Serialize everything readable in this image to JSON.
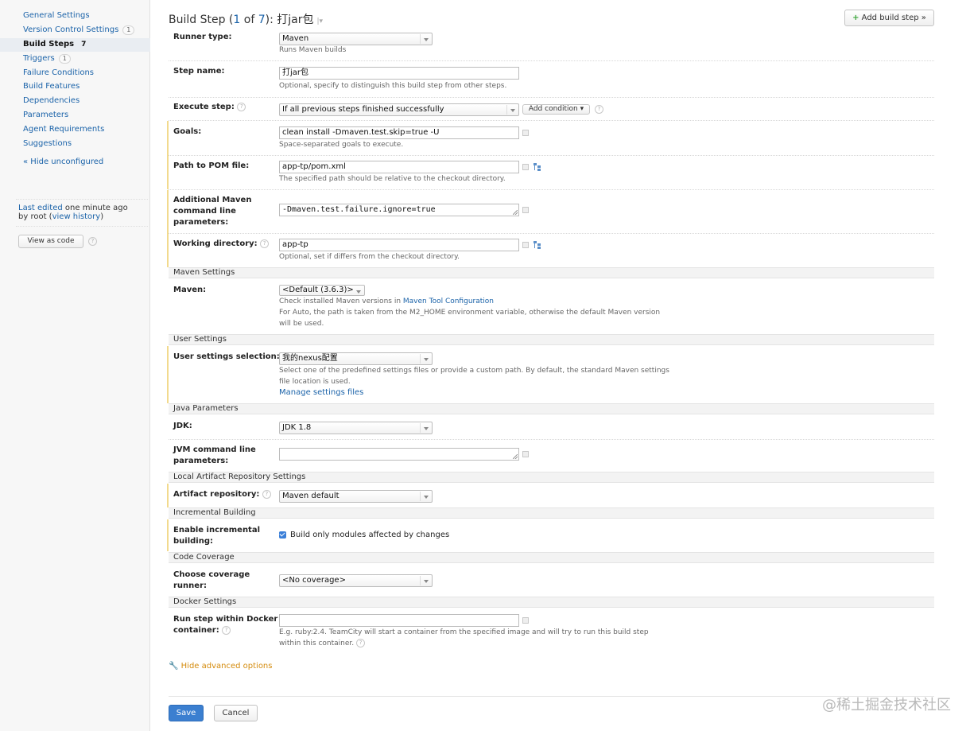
{
  "sidebar": {
    "items": [
      {
        "label": "General Settings",
        "count": ""
      },
      {
        "label": "Version Control Settings",
        "count": "1"
      },
      {
        "label": "Build Steps",
        "count": "7"
      },
      {
        "label": "Triggers",
        "count": "1"
      },
      {
        "label": "Failure Conditions",
        "count": ""
      },
      {
        "label": "Build Features",
        "count": ""
      },
      {
        "label": "Dependencies",
        "count": ""
      },
      {
        "label": "Parameters",
        "count": ""
      },
      {
        "label": "Agent Requirements",
        "count": ""
      },
      {
        "label": "Suggestions",
        "count": ""
      }
    ],
    "hide_unconfigured": "« Hide unconfigured",
    "last_edited_link": "Last edited",
    "last_edited_time": "one minute ago",
    "by_user": "by root",
    "view_history": "view history",
    "view_as_code": "View as code"
  },
  "header": {
    "title_prefix": "Build Step (",
    "step_index": "1",
    "of": " of ",
    "step_total": "7",
    "title_suffix": "): 打jar包",
    "add_build_step": "Add build step »",
    "add_icon": "+"
  },
  "form": {
    "runner_type": {
      "label": "Runner type:",
      "value": "Maven",
      "note": "Runs Maven builds"
    },
    "step_name": {
      "label": "Step name:",
      "value": "打jar包",
      "note": "Optional, specify to distinguish this build step from other steps."
    },
    "execute_step": {
      "label": "Execute step:",
      "value": "If all previous steps finished successfully",
      "add_condition": "Add condition"
    },
    "goals": {
      "label": "Goals:",
      "value": "clean install -Dmaven.test.skip=true -U",
      "note": "Space-separated goals to execute."
    },
    "pom_path": {
      "label": "Path to POM file:",
      "value": "app-tp/pom.xml",
      "note": "The specified path should be relative to the checkout directory."
    },
    "additional_params": {
      "label_1": "Additional Maven",
      "label_2": "command line",
      "label_3": "parameters:",
      "value": "-Dmaven.test.failure.ignore=true"
    },
    "working_dir": {
      "label": "Working directory:",
      "value": "app-tp",
      "note": "Optional, set if differs from the checkout directory."
    },
    "maven_settings": {
      "section": "Maven Settings",
      "label": "Maven:",
      "value": "<Default (3.6.3)>",
      "note_1_prefix": "Check installed Maven versions in ",
      "note_1_link": "Maven Tool Configuration",
      "note_2": "For Auto, the path is taken from the M2_HOME environment variable, otherwise the default Maven version",
      "note_3": "will be used."
    },
    "user_settings": {
      "section": "User Settings",
      "label": "User settings selection:",
      "value": "我的nexus配置",
      "note_1": "Select one of the predefined settings files or provide a custom path. By default, the standard Maven settings",
      "note_2": "file location is used.",
      "manage_link": "Manage settings files"
    },
    "java": {
      "section": "Java Parameters",
      "jdk_label": "JDK:",
      "jdk_value": "JDK 1.8",
      "jvm_label_1": "JVM command line",
      "jvm_label_2": "parameters:",
      "jvm_value": ""
    },
    "local_repo": {
      "section": "Local Artifact Repository Settings",
      "label": "Artifact repository:",
      "value": "Maven default"
    },
    "incremental": {
      "section": "Incremental Building",
      "label_1": "Enable incremental",
      "label_2": "building:",
      "checkbox_label": "Build only modules affected by changes",
      "checked": true
    },
    "coverage": {
      "section": "Code Coverage",
      "label_1": "Choose coverage",
      "label_2": "runner:",
      "value": "<No coverage>"
    },
    "docker": {
      "section": "Docker Settings",
      "label_1": "Run step within Docker",
      "label_2": "container:",
      "value": "",
      "note_1": "E.g. ruby:2.4. TeamCity will start a container from the specified image and will try to run this build step",
      "note_2": "within this container."
    }
  },
  "hide_advanced": "Hide advanced options",
  "actions": {
    "save": "Save",
    "cancel": "Cancel"
  },
  "watermark": "@稀土掘金技术社区",
  "colors": {
    "link": "#1b63a9",
    "primary": "#3b7fd0",
    "highlight": "#f2da8e",
    "advanced": "#d48b0d"
  }
}
